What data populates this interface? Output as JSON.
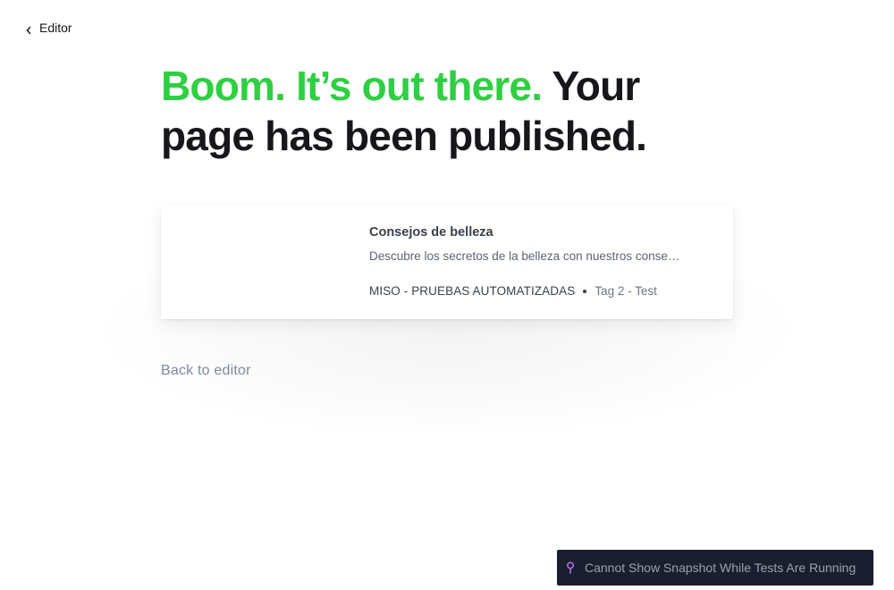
{
  "nav": {
    "back_label": "Editor"
  },
  "headline": {
    "highlight": "Boom. It’s out there.",
    "rest": " Your page has been published."
  },
  "post_card": {
    "title": "Consejos de belleza",
    "excerpt": "Descubre los secretos de la belleza con nuestros conse…",
    "site_name": "MISO - PRUEBAS AUTOMATIZADAS",
    "tags": "Tag 2 - Test"
  },
  "footer": {
    "back_to_editor": "Back to editor"
  },
  "snapshot_notice": {
    "icon": "pin-icon",
    "text": "Cannot Show Snapshot While Tests Are Running"
  },
  "colors": {
    "accent_green": "#30cf43",
    "text_dark": "#15171a",
    "muted_link": "#7c8b9a",
    "notice_bg": "#1b1e2e",
    "notice_icon": "#a76ee8"
  }
}
